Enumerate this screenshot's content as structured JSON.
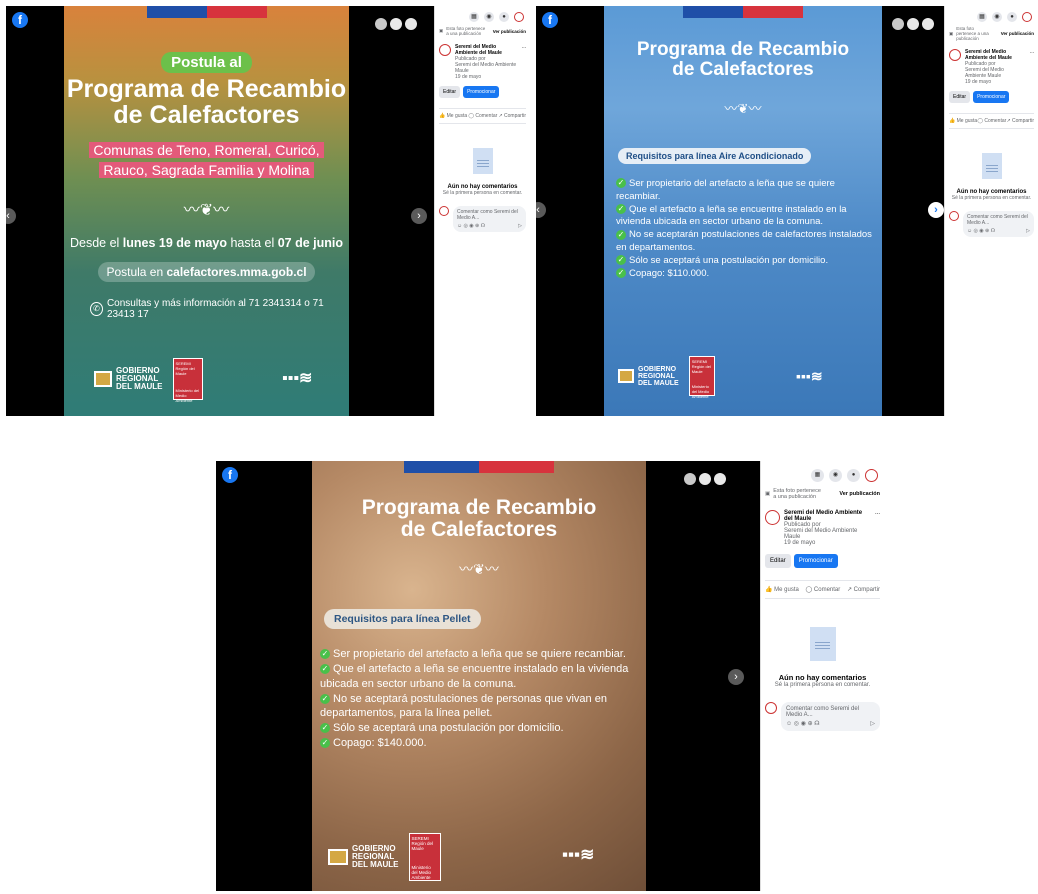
{
  "common": {
    "fb_logo": "f",
    "flag_colors": [
      "#1f4fa8",
      "#d7333d"
    ],
    "next_arrow": "›",
    "prev_arrow": "‹",
    "title_line1": "Programa de Recambio",
    "title_line2": "de Calefactores",
    "logos": {
      "gobierno_line1": "GOBIERNO",
      "gobierno_line2": "REGIONAL",
      "gobierno_line3": "DEL MAULE",
      "seremi_top": "SEREMI",
      "seremi_sub": "Región del Maule",
      "seremi_bottom": "Ministerio del Medio Ambiente",
      "mma_mark": "▪▪▪≋"
    },
    "panel": {
      "photo_note": "Esta foto pertenece a una publicación",
      "view_post": "Ver publicación",
      "page_name": "Seremi del Medio Ambiente del Maule",
      "published_by": "Publicado por",
      "publisher": "Seremi del Medio Ambiente Maule",
      "date": "19 de mayo",
      "edit": "Editar",
      "promote": "Promocionar",
      "like": "Me gusta",
      "comment": "Comentar",
      "share": "Compartir",
      "no_comments": "Aún no hay comentarios",
      "be_first": "Sé la primera persona en comentar.",
      "comment_placeholder": "Comentar como Seremi del Medio A...",
      "more": "...",
      "emoji_icons": "☺ ◎ ◉ ⊕ ☊",
      "send_icon": "▷"
    }
  },
  "slide1": {
    "badge": "Postula al",
    "communes_line1": "Comunas de Teno, Romeral, Curicó,",
    "communes_line2": "Rauco, Sagrada Familia y Molina",
    "dates_pre": "Desde el ",
    "dates_start": "lunes 19 de mayo",
    "dates_mid": " hasta el ",
    "dates_end": "07 de junio",
    "apply_pre": "Postula en ",
    "apply_url": "calefactores.mma.gob.cl",
    "contact": "Consultas y más información al 71 2341314 o 71 23413 17"
  },
  "slide2": {
    "req_title": "Requisitos para línea Aire Acondicionado",
    "requirements": [
      "Ser propietario del artefacto a leña que se quiere recambiar.",
      "Que el artefacto a leña se encuentre instalado en la vivienda ubicada en sector urbano de la comuna.",
      "No se aceptarán postulaciones de calefactores instalados en departamentos.",
      "Sólo se aceptará una postulación por domicilio.",
      "Copago: $110.000."
    ]
  },
  "slide3": {
    "req_title": "Requisitos para línea Pellet",
    "requirements": [
      "Ser propietario del artefacto a leña que se quiere recambiar.",
      "Que el artefacto a leña se encuentre instalado en la vivienda ubicada en sector urbano de la comuna.",
      "No se aceptará postulaciones de personas que vivan en departamentos, para la línea pellet.",
      "Sólo se aceptará una postulación por domicilio.",
      "Copago: $140.000."
    ]
  }
}
